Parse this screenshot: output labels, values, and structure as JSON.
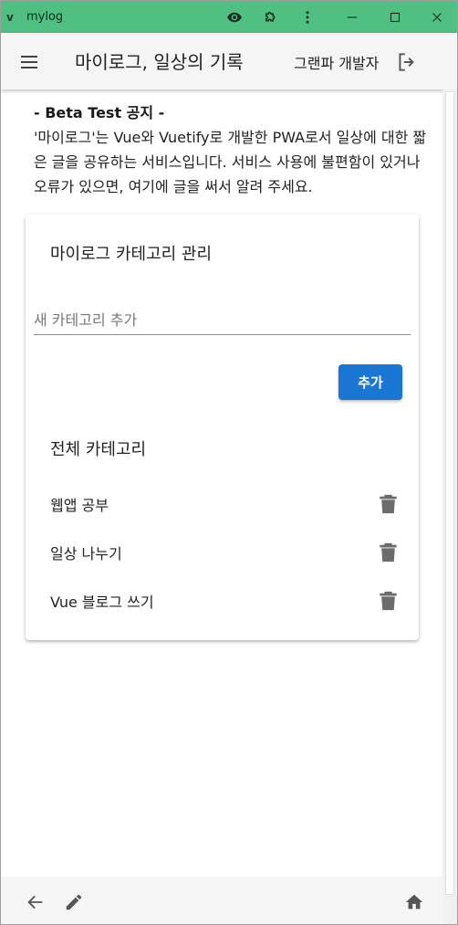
{
  "window": {
    "title": "mylog",
    "icons": [
      "eye-icon",
      "puzzle-icon",
      "kebab-menu-icon",
      "minimize-icon",
      "maximize-icon",
      "close-icon"
    ]
  },
  "appbar": {
    "title": "마이로그, 일상의 기록",
    "user": "그랜파 개발자",
    "icons": [
      "hamburger-menu-icon",
      "logout-icon"
    ]
  },
  "notice": {
    "title": "- Beta Test 공지 -",
    "body": "'마이로그'는 Vue와 Vuetify로 개발한 PWA로서 일상에 대한 짧은 글을 공유하는 서비스입니다. 서비스 사용에 불편함이 있거나 오류가 있으면, 여기에 글을 써서 알려 주세요."
  },
  "category_manager": {
    "title": "마이로그 카테고리 관리",
    "input_placeholder": "새 카테고리 추가",
    "input_value": "",
    "add_label": "추가",
    "list_title": "전체 카테고리",
    "categories": [
      {
        "label": "웹앱 공부"
      },
      {
        "label": "일상 나누기"
      },
      {
        "label": "Vue 블로그 쓰기"
      }
    ]
  },
  "bottombar": {
    "icons": [
      "back-arrow-icon",
      "pencil-icon",
      "home-icon"
    ]
  },
  "colors": {
    "titlebar": "#4fbf82",
    "appbar": "#f5f5f5",
    "primary_button": "#1976d2",
    "icon_gray": "#6b6b6b"
  }
}
